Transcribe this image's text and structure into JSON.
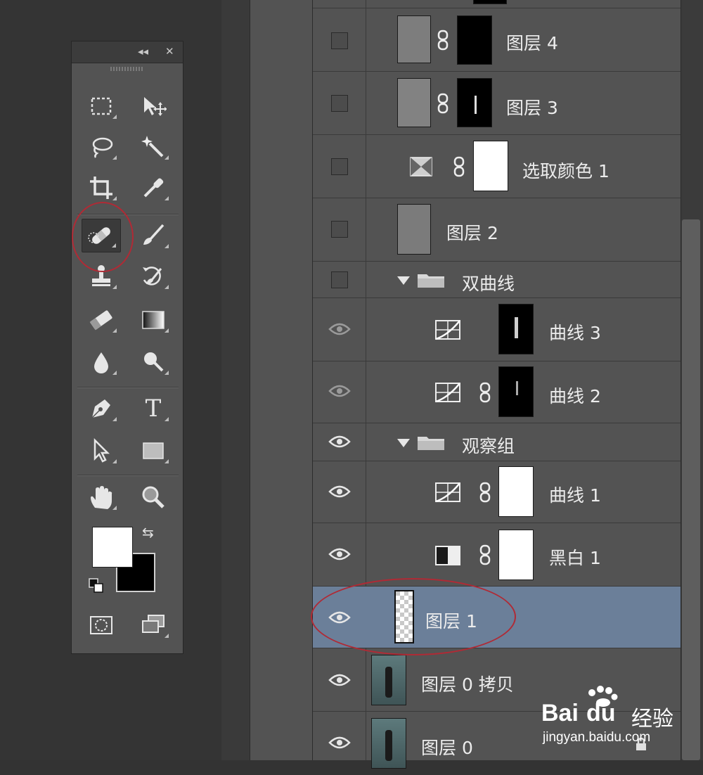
{
  "toolbox": {
    "collapse_glyph": "◂◂",
    "close_glyph": "✕",
    "tools": [
      {
        "name": "rectangular-marquee-tool",
        "icon": "marquee-icon"
      },
      {
        "name": "move-tool",
        "icon": "move-icon"
      },
      {
        "name": "lasso-tool",
        "icon": "lasso-icon"
      },
      {
        "name": "magic-wand-tool",
        "icon": "magic-wand-icon"
      },
      {
        "name": "crop-tool",
        "icon": "crop-icon"
      },
      {
        "name": "eyedropper-tool",
        "icon": "eyedropper-icon"
      },
      {
        "name": "spot-healing-brush-tool",
        "icon": "bandage-icon",
        "active": true
      },
      {
        "name": "brush-tool",
        "icon": "brush-icon"
      },
      {
        "name": "clone-stamp-tool",
        "icon": "stamp-icon"
      },
      {
        "name": "history-brush-tool",
        "icon": "history-brush-icon"
      },
      {
        "name": "eraser-tool",
        "icon": "eraser-icon"
      },
      {
        "name": "gradient-tool",
        "icon": "gradient-icon"
      },
      {
        "name": "blur-tool",
        "icon": "drop-icon"
      },
      {
        "name": "dodge-tool",
        "icon": "dodge-icon"
      },
      {
        "name": "pen-tool",
        "icon": "pen-icon"
      },
      {
        "name": "type-tool",
        "icon": "type-icon",
        "glyph": "T"
      },
      {
        "name": "path-selection-tool",
        "icon": "arrow-icon"
      },
      {
        "name": "rectangle-tool",
        "icon": "rectangle-icon"
      },
      {
        "name": "hand-tool",
        "icon": "hand-icon"
      },
      {
        "name": "zoom-tool",
        "icon": "zoom-icon"
      },
      {
        "name": "quick-mask-button",
        "icon": "quick-mask-icon"
      },
      {
        "name": "screen-mode-button",
        "icon": "screen-mode-icon"
      }
    ],
    "foreground_color": "#ffffff",
    "background_color": "#000000",
    "swap_glyph": "⇆"
  },
  "layers": {
    "items": [
      {
        "name": "图层 4",
        "visible": false
      },
      {
        "name": "图层 3",
        "visible": false
      },
      {
        "name": "选取颜色 1",
        "visible": false
      },
      {
        "name": "图层 2",
        "visible": false
      },
      {
        "name": "双曲线",
        "visible": false,
        "group": true
      },
      {
        "name": "曲线 3",
        "visible": true
      },
      {
        "name": "曲线 2",
        "visible": true
      },
      {
        "name": "观察组",
        "visible": true,
        "group": true
      },
      {
        "name": "曲线 1",
        "visible": true
      },
      {
        "name": "黑白 1",
        "visible": true
      },
      {
        "name": "图层 1",
        "visible": true,
        "selected": true
      },
      {
        "name": "图层 0 拷贝",
        "visible": true
      },
      {
        "name": "图层 0",
        "visible": true
      }
    ],
    "selected_color": "#6b7f99",
    "annotation_color": "#b02a35"
  },
  "watermark": {
    "brand": "Bai",
    "brand_cn": "经验",
    "url": "jingyan.baidu.com"
  }
}
